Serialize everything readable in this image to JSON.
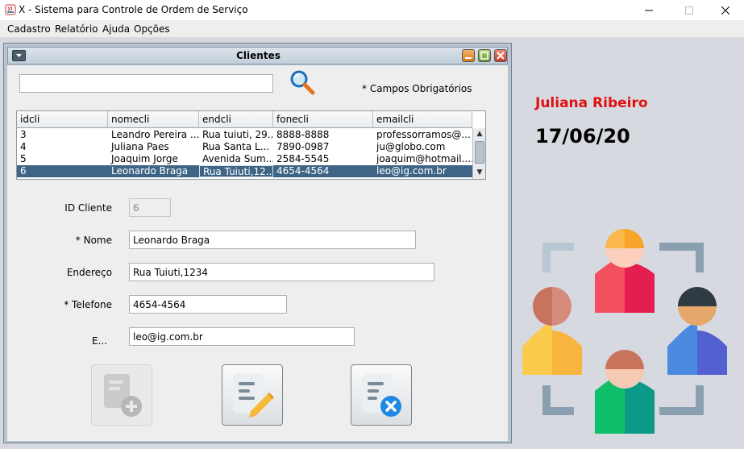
{
  "window": {
    "title": "X - Sistema para Controle de Ordem de Serviço"
  },
  "menubar": {
    "items": [
      {
        "label": "Cadastro"
      },
      {
        "label": "Relatório"
      },
      {
        "label": "Ajuda"
      },
      {
        "label": "Opções"
      }
    ]
  },
  "frame": {
    "title": "Clientes",
    "search": {
      "value": "",
      "placeholder": ""
    },
    "required_note": "* Campos Obrigatórios",
    "table": {
      "columns": [
        "idcli",
        "nomecli",
        "endcli",
        "fonecli",
        "emailcli"
      ],
      "rows": [
        [
          "3",
          "Leandro Pereira ...",
          "Rua tuiuti, 29...",
          "8888-8888",
          "professorramos@..."
        ],
        [
          "4",
          "Juliana Paes",
          "Rua Santa L...",
          "7890-0987",
          "ju@globo.com"
        ],
        [
          "5",
          "Joaquim Jorge",
          "Avenida Sum...",
          "2584-5545",
          "joaquim@hotmail...."
        ],
        [
          "6",
          "Leonardo Braga",
          "Rua Tuiuti,12...",
          "4654-4564",
          "leo@ig.com.br"
        ]
      ],
      "selected_row": 3
    },
    "form": {
      "id": {
        "label": "ID Cliente",
        "value": "6"
      },
      "nome": {
        "label": "* Nome",
        "value": "Leonardo Braga"
      },
      "endereco": {
        "label": "Endereço",
        "value": "Rua Tuiuti,1234"
      },
      "telefone": {
        "label": "* Telefone",
        "value": "4654-4564"
      },
      "email": {
        "label": "E...",
        "value": "leo@ig.com.br"
      }
    },
    "buttons": {
      "add": {
        "icon": "document-add-icon",
        "enabled": false
      },
      "edit": {
        "icon": "document-edit-icon",
        "enabled": true
      },
      "delete": {
        "icon": "document-delete-icon",
        "enabled": true
      }
    }
  },
  "sidebar": {
    "user_name": "Juliana Ribeiro",
    "date": "17/06/20",
    "illustration": "people-network-icon"
  },
  "colors": {
    "user_name": "#e01010",
    "selection": "#3e6585",
    "desktop": "#d7d9e0",
    "frame_border": "#b8c4cf"
  }
}
